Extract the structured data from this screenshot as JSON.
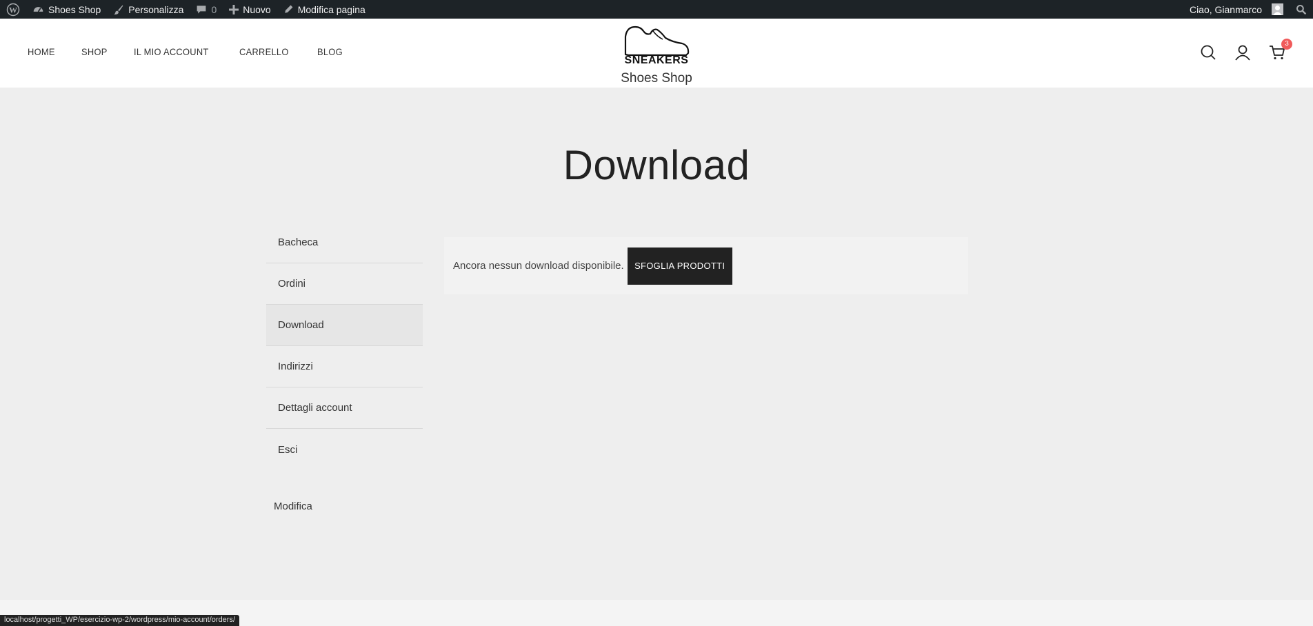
{
  "adminbar": {
    "site_name": "Shoes Shop",
    "customize": "Personalizza",
    "comments_count": "0",
    "new": "Nuovo",
    "edit_page": "Modifica pagina",
    "greeting": "Ciao, Gianmarco"
  },
  "header": {
    "nav": [
      "HOME",
      "SHOP",
      "IL MIO ACCOUNT",
      "CARRELLO",
      "BLOG"
    ],
    "logo_text": "SNEAKERS",
    "site_title": "Shoes Shop",
    "cart_count": "3"
  },
  "page": {
    "title": "Download",
    "account_nav": [
      "Bacheca",
      "Ordini",
      "Download",
      "Indirizzi",
      "Dettagli account",
      "Esci"
    ],
    "active_item": "Download",
    "edit_link": "Modifica",
    "notice_text": "Ancora nessun download disponibile.",
    "notice_button": "SFOGLIA PRODOTTI"
  },
  "status_bar": {
    "url": "localhost/progetti_WP/esercizio-wp-2/wordpress/mio-account/orders/"
  },
  "colors": {
    "adminbar_bg": "#1d2327",
    "page_bg": "#eeeeee",
    "button_bg": "#222222",
    "cart_badge": "#f05a5a"
  }
}
